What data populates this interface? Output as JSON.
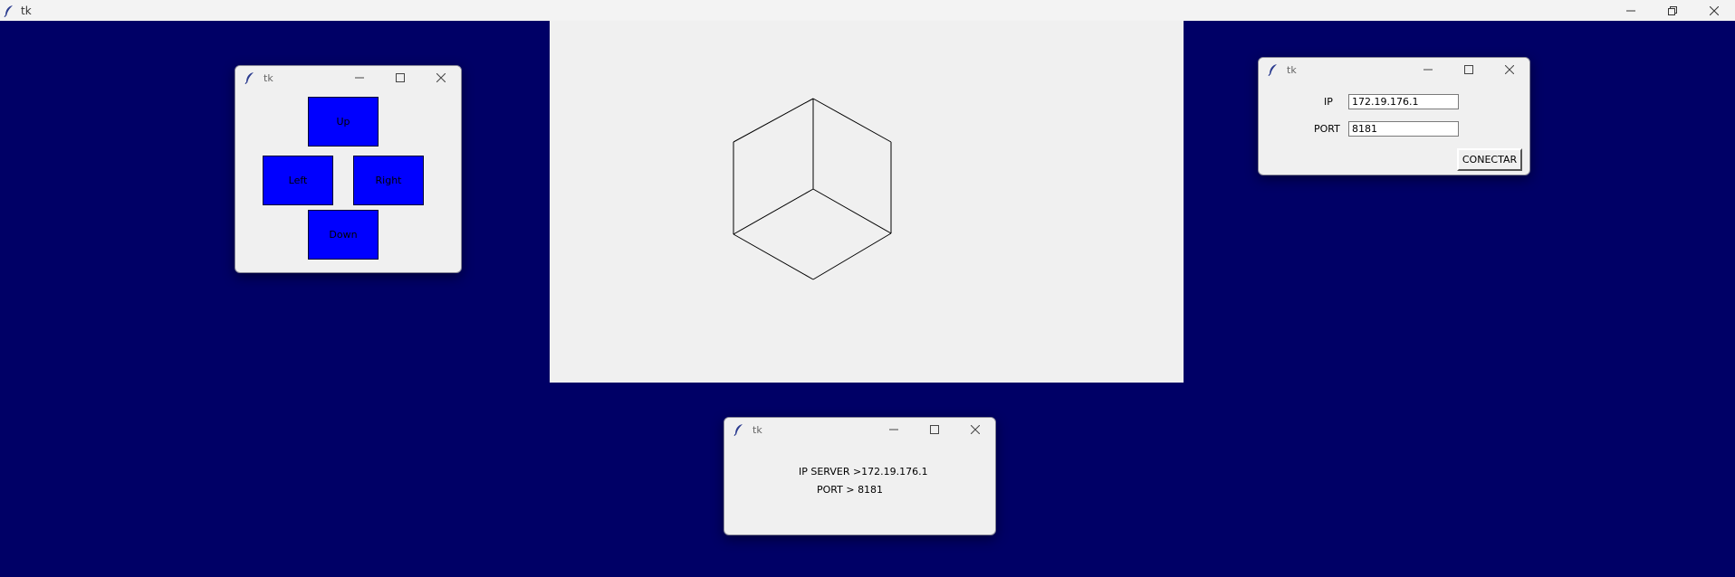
{
  "main_window": {
    "title": "tk"
  },
  "control_window": {
    "title": "tk",
    "buttons": {
      "up": "Up",
      "left": "Left",
      "right": "Right",
      "down": "Down"
    }
  },
  "connect_window": {
    "title": "tk",
    "ip_label": "IP",
    "ip_value": "172.19.176.1",
    "port_label": "PORT",
    "port_value": "8181",
    "connect_label": "CONECTAR"
  },
  "info_window": {
    "title": "tk",
    "line1": "IP SERVER >172.19.176.1",
    "line2": "PORT > 8181"
  },
  "colors": {
    "desktop": "#000066",
    "button_blue": "#0000ff",
    "window_bg": "#f0f0f0"
  },
  "icons": [
    "feather-icon",
    "minimize-icon",
    "maximize-icon",
    "restore-icon",
    "close-icon"
  ]
}
